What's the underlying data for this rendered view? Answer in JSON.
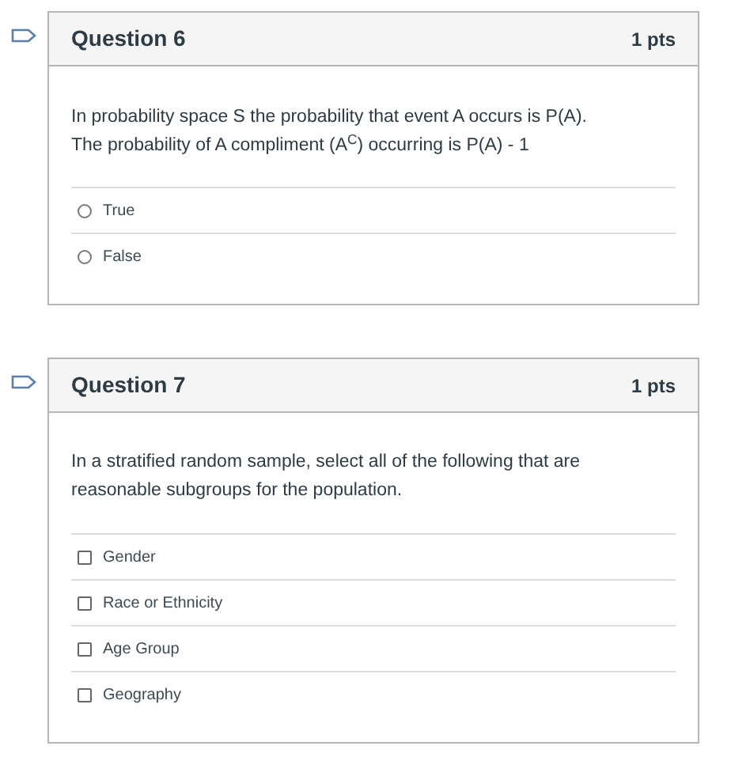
{
  "questions": [
    {
      "title": "Question 6",
      "points": "1 pts",
      "text": "In probability space S the probability that event A occurs is P(A). The probability of A compliment (A$^{C}$) occurring is P(A) - 1",
      "options": [
        {
          "kind": "radio",
          "label": "True",
          "checked": false
        },
        {
          "kind": "radio",
          "label": "False",
          "checked": false
        }
      ]
    },
    {
      "title": "Question 7",
      "points": "1 pts",
      "text": "In a stratified random sample, select all of the following that are reasonable subgroups for the population.",
      "options": [
        {
          "kind": "checkbox",
          "label": "Gender",
          "checked": false
        },
        {
          "kind": "checkbox",
          "label": "Race or Ethnicity",
          "checked": false
        },
        {
          "kind": "checkbox",
          "label": "Age Group",
          "checked": false
        },
        {
          "kind": "checkbox",
          "label": "Geography",
          "checked": false
        }
      ]
    }
  ]
}
